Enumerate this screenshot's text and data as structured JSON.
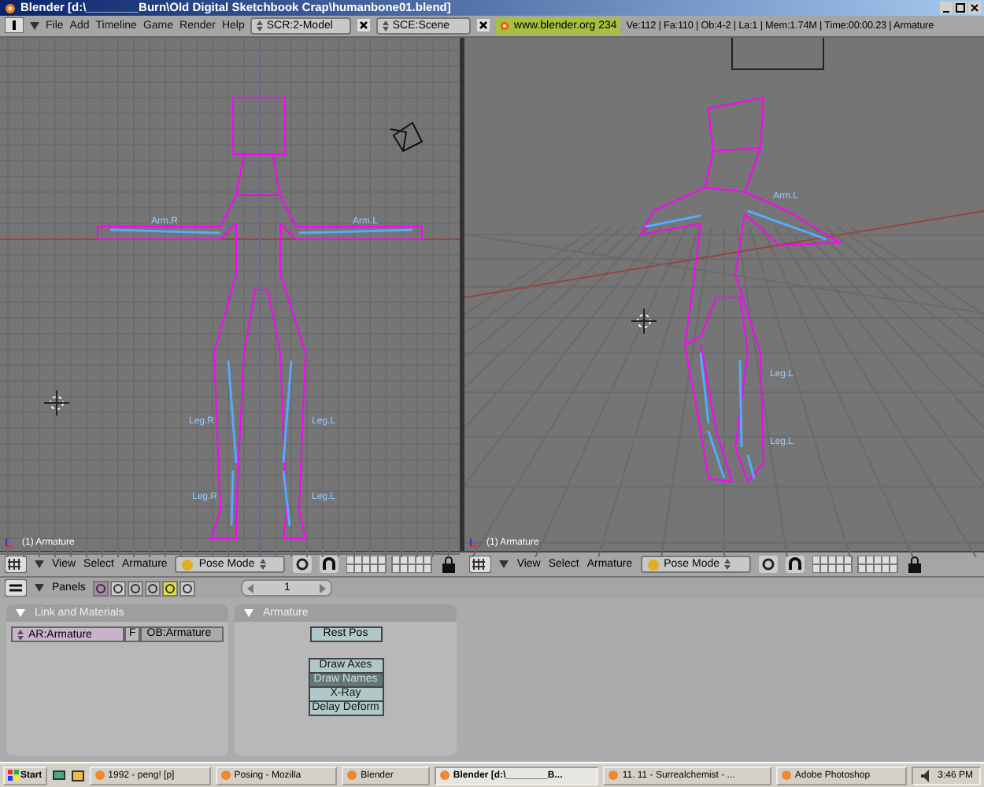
{
  "window": {
    "title": "Blender [d:\\________Burn\\Old Digital Sketchbook Crap\\humanbone01.blend]"
  },
  "menu_bar": {
    "menus": [
      "File",
      "Add",
      "Timeline",
      "Game",
      "Render",
      "Help"
    ],
    "screen": "SCR:2-Model",
    "scene": "SCE:Scene",
    "info": "www.blender.org 234",
    "stats": "Ve:112 | Fa:110 | Ob:4-2 | La:1 | Mem:1.74M | Time:00:00.23 | Armature"
  },
  "viewports": [
    {
      "kind": "front",
      "label": "(1) Armature",
      "bone_labels": [
        "Arm.R",
        "Arm.L",
        "Leg.R",
        "Leg.L",
        "Leg.R",
        "Leg.L"
      ]
    },
    {
      "kind": "perspective",
      "label": "(1) Armature",
      "bone_labels": [
        "Arm.L",
        "Leg.L",
        "Leg.L"
      ]
    }
  ],
  "view_headers": [
    {
      "menus": [
        "View",
        "Select",
        "Armature"
      ],
      "mode": "Pose Mode"
    },
    {
      "menus": [
        "View",
        "Select",
        "Armature"
      ],
      "mode": "Pose Mode"
    }
  ],
  "buttons_header": {
    "label": "Panels",
    "frame": "1"
  },
  "panels": [
    {
      "kind": "link",
      "title": "Link and Materials",
      "armature_field": "AR:Armature",
      "fake_user": "F",
      "object_field": "OB:Armature"
    },
    {
      "kind": "armature",
      "title": "Armature",
      "rest_button": "Rest Pos",
      "toggles": [
        {
          "label": "Draw Axes",
          "on": false
        },
        {
          "label": "Draw Names",
          "on": true
        },
        {
          "label": "X-Ray",
          "on": false
        },
        {
          "label": "Delay Deform",
          "on": false
        }
      ]
    }
  ],
  "taskbar": {
    "start": "Start",
    "tasks": [
      {
        "label": "1992 - peng! [p]",
        "selected": false
      },
      {
        "label": "Posing - Mozilla",
        "selected": false
      },
      {
        "label": "Blender",
        "selected": false
      },
      {
        "label": "Blender [d:\\________B...",
        "selected": true
      },
      {
        "label": "11. 11 - Surrealchemist - ...",
        "selected": false
      },
      {
        "label": "Adobe Photoshop",
        "selected": false
      }
    ],
    "clock": "3:46 PM"
  }
}
